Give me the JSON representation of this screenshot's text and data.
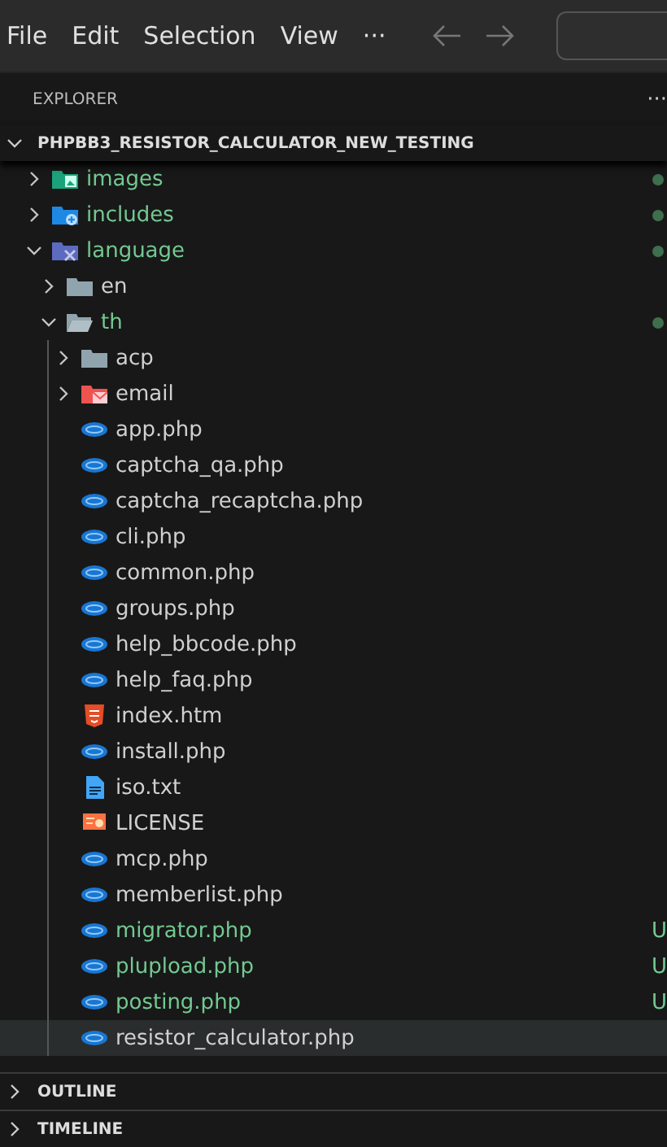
{
  "menu": [
    "File",
    "Edit",
    "Selection",
    "View",
    "···"
  ],
  "explorer": {
    "title": "EXPLORER",
    "more": "···"
  },
  "root": {
    "name": "PHPBB3_RESISTOR_CALCULATOR_NEW_TESTING",
    "expanded": true
  },
  "tree": [
    {
      "name": "images",
      "kind": "images-folder",
      "expanded": false,
      "untracked": true,
      "selected": false
    },
    {
      "name": "includes",
      "kind": "includes-folder",
      "expanded": false,
      "untracked": true,
      "selected": false
    },
    {
      "name": "language",
      "kind": "language-folder",
      "expanded": true,
      "untracked": true,
      "selected": false,
      "children": [
        {
          "name": "en",
          "kind": "folder",
          "expanded": false,
          "untracked": false,
          "selected": false
        },
        {
          "name": "th",
          "kind": "folder",
          "expanded": true,
          "untracked": true,
          "selected": false,
          "children": [
            {
              "name": "acp",
              "kind": "folder",
              "expanded": false,
              "untracked": false,
              "selected": false
            },
            {
              "name": "email",
              "kind": "email-folder",
              "expanded": false,
              "untracked": false,
              "selected": false
            },
            {
              "name": "app.php",
              "kind": "php",
              "untracked": false,
              "selected": false
            },
            {
              "name": "captcha_qa.php",
              "kind": "php",
              "untracked": false,
              "selected": false
            },
            {
              "name": "captcha_recaptcha.php",
              "kind": "php",
              "untracked": false,
              "selected": false
            },
            {
              "name": "cli.php",
              "kind": "php",
              "untracked": false,
              "selected": false
            },
            {
              "name": "common.php",
              "kind": "php",
              "untracked": false,
              "selected": false
            },
            {
              "name": "groups.php",
              "kind": "php",
              "untracked": false,
              "selected": false
            },
            {
              "name": "help_bbcode.php",
              "kind": "php",
              "untracked": false,
              "selected": false
            },
            {
              "name": "help_faq.php",
              "kind": "php",
              "untracked": false,
              "selected": false
            },
            {
              "name": "index.htm",
              "kind": "html",
              "untracked": false,
              "selected": false
            },
            {
              "name": "install.php",
              "kind": "php",
              "untracked": false,
              "selected": false
            },
            {
              "name": "iso.txt",
              "kind": "text",
              "untracked": false,
              "selected": false
            },
            {
              "name": "LICENSE",
              "kind": "license",
              "untracked": false,
              "selected": false
            },
            {
              "name": "mcp.php",
              "kind": "php",
              "untracked": false,
              "selected": false
            },
            {
              "name": "memberlist.php",
              "kind": "php",
              "untracked": false,
              "selected": false
            },
            {
              "name": "migrator.php",
              "kind": "php",
              "untracked": true,
              "badge": "U",
              "selected": false
            },
            {
              "name": "plupload.php",
              "kind": "php",
              "untracked": true,
              "badge": "U",
              "selected": false
            },
            {
              "name": "posting.php",
              "kind": "php",
              "untracked": true,
              "badge": "U",
              "selected": false
            },
            {
              "name": "resistor_calculator.php",
              "kind": "php",
              "untracked": false,
              "selected": true
            }
          ]
        }
      ]
    }
  ],
  "panels": [
    {
      "title": "OUTLINE",
      "expanded": false
    },
    {
      "title": "TIMELINE",
      "expanded": false
    }
  ]
}
